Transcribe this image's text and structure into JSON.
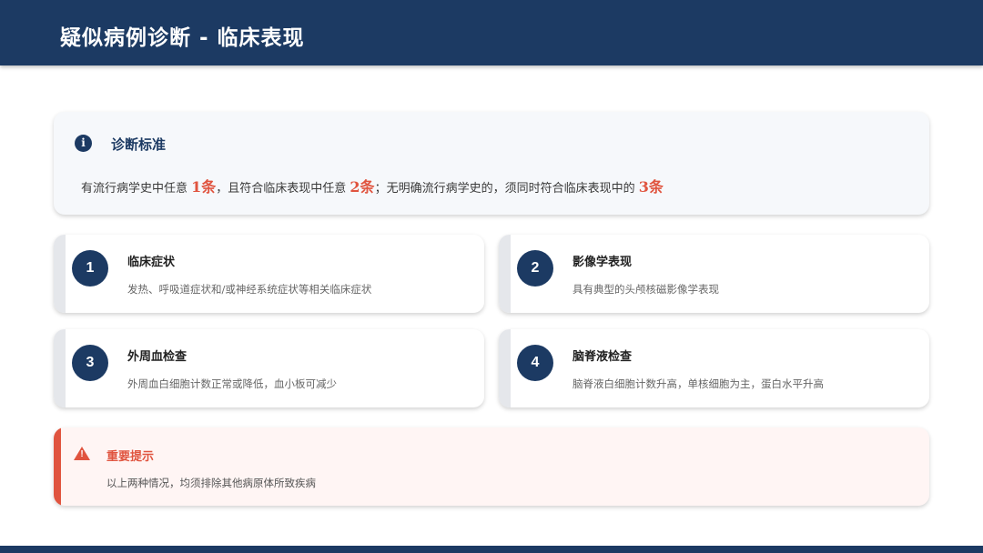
{
  "header": {
    "title": "疑似病例诊断 - 临床表现"
  },
  "criteria": {
    "title": "诊断标准",
    "icon": "info-icon",
    "text_1": "有流行病学史中任意 ",
    "hl_1": "1条",
    "text_2": "，且符合临床表现中任意 ",
    "hl_2": "2条",
    "text_3": "；无明确流行病学史的，须同时符合临床表现中的 ",
    "hl_3": "3条",
    "highlight_color": "#e0543f"
  },
  "items": [
    {
      "num": "1",
      "title": "临床症状",
      "desc": "发热、呼吸道症状和/或神经系统症状等相关临床症状"
    },
    {
      "num": "2",
      "title": "影像学表现",
      "desc": "具有典型的头颅核磁影像学表现"
    },
    {
      "num": "3",
      "title": "外周血检查",
      "desc": "外周血白细胞计数正常或降低，血小板可减少"
    },
    {
      "num": "4",
      "title": "脑脊液检查",
      "desc": "脑脊液白细胞计数升高，单核细胞为主，蛋白水平升高"
    }
  ],
  "warning": {
    "title": "重要提示",
    "text": "以上两种情况，均须排除其他病原体所致疾病",
    "icon": "warning-triangle-icon",
    "color": "#e0543f"
  },
  "colors": {
    "primary": "#1c3a63",
    "accent": "#e0543f"
  }
}
